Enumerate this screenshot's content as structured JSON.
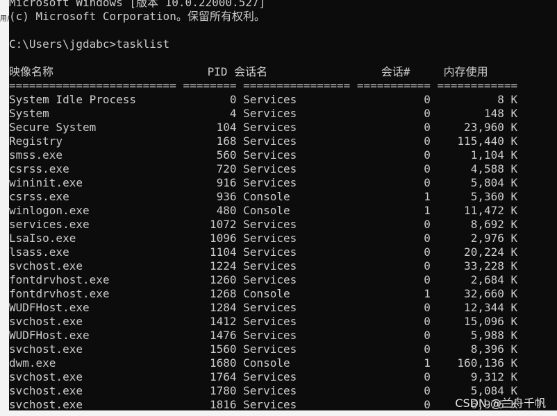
{
  "terminal": {
    "header_line1": "Microsoft Windows [版本 10.0.22000.527]",
    "header_line2": "(c) Microsoft Corporation。保留所有权利。",
    "prompt": "C:\\Users\\jgdabc>tasklist",
    "columns": {
      "image_name": "映像名称",
      "pid": "PID",
      "session_name": "会话名",
      "session_num": "会话#",
      "mem_usage": "内存使用"
    },
    "separator": "========================= ======== ================ =========== ============",
    "rows": [
      {
        "name": "System Idle Process",
        "pid": "0",
        "session": "Services",
        "num": "0",
        "mem": "8 K"
      },
      {
        "name": "System",
        "pid": "4",
        "session": "Services",
        "num": "0",
        "mem": "148 K"
      },
      {
        "name": "Secure System",
        "pid": "104",
        "session": "Services",
        "num": "0",
        "mem": "23,960 K"
      },
      {
        "name": "Registry",
        "pid": "168",
        "session": "Services",
        "num": "0",
        "mem": "115,440 K"
      },
      {
        "name": "smss.exe",
        "pid": "560",
        "session": "Services",
        "num": "0",
        "mem": "1,104 K"
      },
      {
        "name": "csrss.exe",
        "pid": "720",
        "session": "Services",
        "num": "0",
        "mem": "4,588 K"
      },
      {
        "name": "wininit.exe",
        "pid": "916",
        "session": "Services",
        "num": "0",
        "mem": "5,804 K"
      },
      {
        "name": "csrss.exe",
        "pid": "936",
        "session": "Console",
        "num": "1",
        "mem": "5,360 K"
      },
      {
        "name": "winlogon.exe",
        "pid": "480",
        "session": "Console",
        "num": "1",
        "mem": "11,472 K"
      },
      {
        "name": "services.exe",
        "pid": "1072",
        "session": "Services",
        "num": "0",
        "mem": "8,692 K"
      },
      {
        "name": "LsaIso.exe",
        "pid": "1096",
        "session": "Services",
        "num": "0",
        "mem": "2,976 K"
      },
      {
        "name": "lsass.exe",
        "pid": "1104",
        "session": "Services",
        "num": "0",
        "mem": "20,224 K"
      },
      {
        "name": "svchost.exe",
        "pid": "1224",
        "session": "Services",
        "num": "0",
        "mem": "33,228 K"
      },
      {
        "name": "fontdrvhost.exe",
        "pid": "1260",
        "session": "Services",
        "num": "0",
        "mem": "2,684 K"
      },
      {
        "name": "fontdrvhost.exe",
        "pid": "1268",
        "session": "Console",
        "num": "1",
        "mem": "32,660 K"
      },
      {
        "name": "WUDFHost.exe",
        "pid": "1284",
        "session": "Services",
        "num": "0",
        "mem": "12,344 K"
      },
      {
        "name": "svchost.exe",
        "pid": "1412",
        "session": "Services",
        "num": "0",
        "mem": "15,096 K"
      },
      {
        "name": "WUDFHost.exe",
        "pid": "1476",
        "session": "Services",
        "num": "0",
        "mem": "5,988 K"
      },
      {
        "name": "svchost.exe",
        "pid": "1560",
        "session": "Services",
        "num": "0",
        "mem": "8,396 K"
      },
      {
        "name": "dwm.exe",
        "pid": "1680",
        "session": "Console",
        "num": "1",
        "mem": "160,136 K"
      },
      {
        "name": "svchost.exe",
        "pid": "1764",
        "session": "Services",
        "num": "0",
        "mem": "9,312 K"
      },
      {
        "name": "svchost.exe",
        "pid": "1780",
        "session": "Services",
        "num": "0",
        "mem": "5,084 K"
      },
      {
        "name": "svchost.exe",
        "pid": "1816",
        "session": "Services",
        "num": "0",
        "mem": "6,976 K"
      }
    ]
  },
  "left_strip_text": "用户",
  "watermark": "CSDN @兰舟千帆"
}
